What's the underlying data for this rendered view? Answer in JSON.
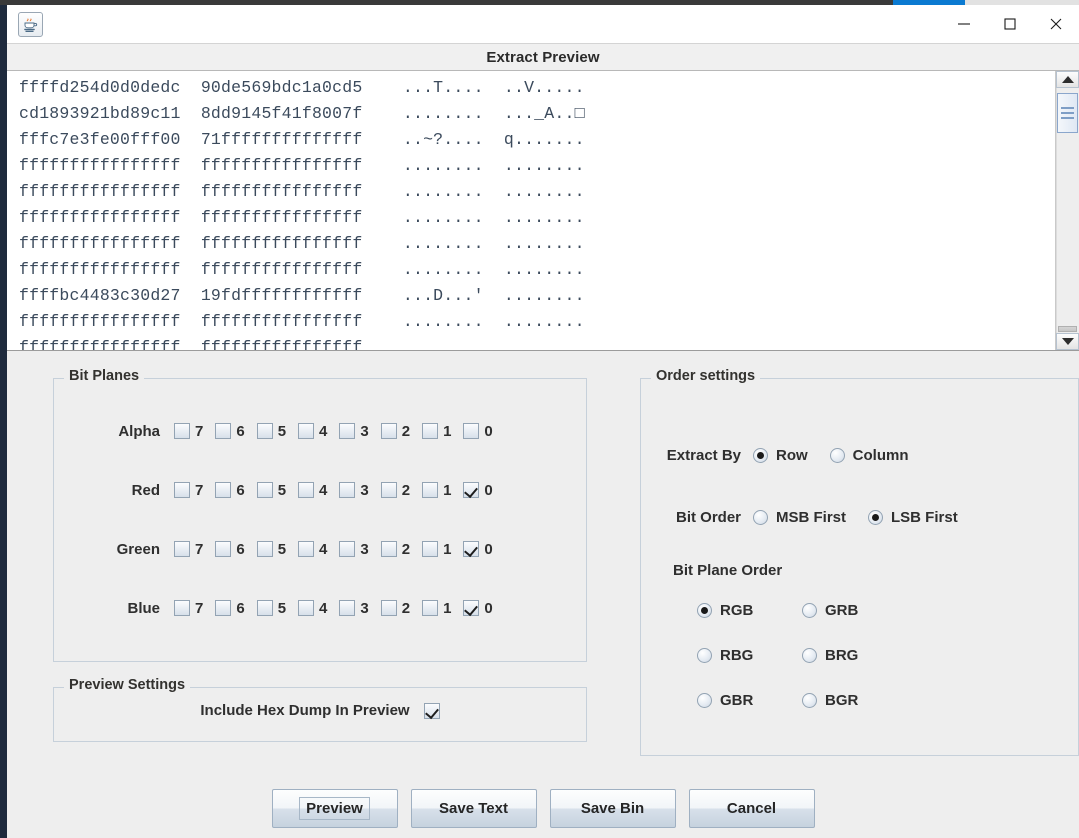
{
  "window": {
    "app_icon": "java-coffee-cup-icon",
    "minimize_label": "minimize-icon",
    "maximize_label": "maximize-icon",
    "close_label": "close-icon"
  },
  "dialog": {
    "title": "Extract Preview"
  },
  "hex_preview": {
    "rows": [
      {
        "hex1": "ffffd254d0d0dedc",
        "hex2": "90de569bdc1a0cd5",
        "ascii1": "...T....",
        "ascii2": "..V....."
      },
      {
        "hex1": "cd1893921bd89c11",
        "hex2": "8dd9145f41f8007f",
        "ascii1": "........",
        "ascii2": "..._A..□"
      },
      {
        "hex1": "fffc7e3fe00fff00",
        "hex2": "71ffffffffffffff",
        "ascii1": "..~?....",
        "ascii2": "q......."
      },
      {
        "hex1": "ffffffffffffffff",
        "hex2": "ffffffffffffffff",
        "ascii1": "........",
        "ascii2": "........"
      },
      {
        "hex1": "ffffffffffffffff",
        "hex2": "ffffffffffffffff",
        "ascii1": "........",
        "ascii2": "........"
      },
      {
        "hex1": "ffffffffffffffff",
        "hex2": "ffffffffffffffff",
        "ascii1": "........",
        "ascii2": "........"
      },
      {
        "hex1": "ffffffffffffffff",
        "hex2": "ffffffffffffffff",
        "ascii1": "........",
        "ascii2": "........"
      },
      {
        "hex1": "ffffffffffffffff",
        "hex2": "ffffffffffffffff",
        "ascii1": "........",
        "ascii2": "........"
      },
      {
        "hex1": "ffffbc4483c30d27",
        "hex2": "19fdffffffffffff",
        "ascii1": "...D...'",
        "ascii2": "........"
      },
      {
        "hex1": "ffffffffffffffff",
        "hex2": "ffffffffffffffff",
        "ascii1": "........",
        "ascii2": "........"
      },
      {
        "hex1": "ffffffffffffffff",
        "hex2": "ffffffffffffffff",
        "ascii1": "",
        "ascii2": ""
      }
    ],
    "scrollbar": {
      "up_arrow": "scroll-up-icon",
      "down_arrow": "scroll-down-icon"
    }
  },
  "bit_planes": {
    "legend": "Bit Planes",
    "bit_labels": [
      "7",
      "6",
      "5",
      "4",
      "3",
      "2",
      "1",
      "0"
    ],
    "channels": [
      {
        "name": "Alpha",
        "checked": [
          false,
          false,
          false,
          false,
          false,
          false,
          false,
          false
        ]
      },
      {
        "name": "Red",
        "checked": [
          false,
          false,
          false,
          false,
          false,
          false,
          false,
          true
        ]
      },
      {
        "name": "Green",
        "checked": [
          false,
          false,
          false,
          false,
          false,
          false,
          false,
          true
        ]
      },
      {
        "name": "Blue",
        "checked": [
          false,
          false,
          false,
          false,
          false,
          false,
          false,
          true
        ]
      }
    ]
  },
  "preview_settings": {
    "legend": "Preview Settings",
    "include_hex_dump_label": "Include Hex Dump In Preview",
    "include_hex_dump_checked": true
  },
  "order_settings": {
    "legend": "Order settings",
    "extract_by": {
      "label": "Extract By",
      "options": [
        {
          "label": "Row",
          "selected": true
        },
        {
          "label": "Column",
          "selected": false
        }
      ]
    },
    "bit_order": {
      "label": "Bit Order",
      "options": [
        {
          "label": "MSB First",
          "selected": false
        },
        {
          "label": "LSB First",
          "selected": true
        }
      ]
    },
    "bit_plane_order": {
      "label": "Bit Plane Order",
      "options": [
        {
          "label": "RGB",
          "selected": true
        },
        {
          "label": "GRB",
          "selected": false
        },
        {
          "label": "RBG",
          "selected": false
        },
        {
          "label": "BRG",
          "selected": false
        },
        {
          "label": "GBR",
          "selected": false
        },
        {
          "label": "BGR",
          "selected": false
        }
      ]
    }
  },
  "buttons": [
    {
      "label": "Preview",
      "focused": true
    },
    {
      "label": "Save Text",
      "focused": false
    },
    {
      "label": "Save Bin",
      "focused": false
    },
    {
      "label": "Cancel",
      "focused": false
    }
  ],
  "colors": {
    "panel_bg": "#eeeeee",
    "hex_text": "#3b4a5c",
    "accent_blue": "#0b7ad1",
    "border": "#c6d0da"
  }
}
